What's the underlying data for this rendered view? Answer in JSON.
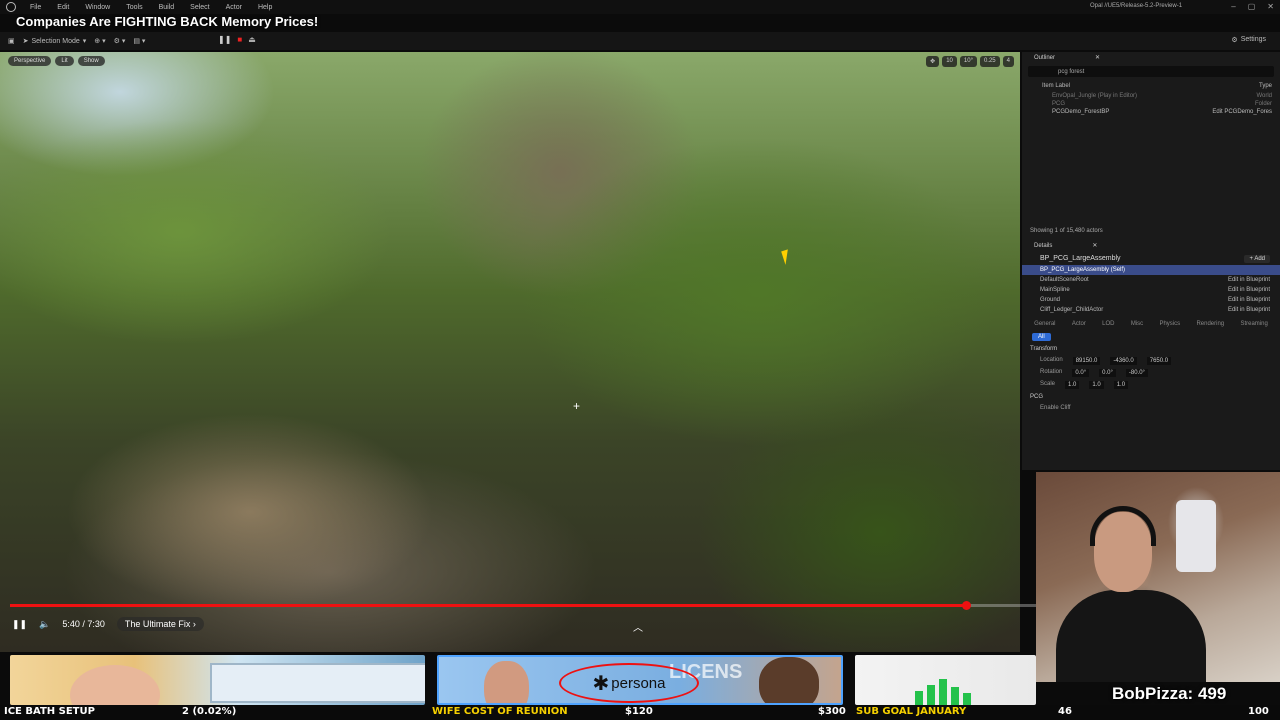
{
  "menubar": {
    "items": [
      "File",
      "Edit",
      "Window",
      "Tools",
      "Build",
      "Select",
      "Actor",
      "Help"
    ],
    "project": "Opal //UE5/Release-5.2-Preview-1"
  },
  "video": {
    "title": "Companies Are FIGHTING BACK Memory Prices!",
    "time": "5:40 / 7:30",
    "chapter": "The Ultimate Fix",
    "chapter_chevron": "›",
    "progress": 0.93
  },
  "toolbar": {
    "selection_mode": "Selection Mode",
    "settings": "Settings"
  },
  "viewport": {
    "tabs": [
      "Perspective",
      "Lit",
      "Show"
    ],
    "tools": [
      "10",
      "10°",
      "0.25",
      "4"
    ]
  },
  "outliner": {
    "tab": "Outliner",
    "search": "pcg forest",
    "col_label": "Item Label",
    "col_type": "Type",
    "rows": [
      {
        "label": "EnvOpal_Jungle (Play in Editor)",
        "type": "World"
      },
      {
        "label": "PCG",
        "type": "Folder"
      },
      {
        "label": "PCGDemo_ForestBP",
        "type": "Edit PCGDemo_Fores"
      }
    ],
    "status": "Showing 1 of 15,480 actors"
  },
  "details": {
    "tab": "Details",
    "actor": "BP_PCG_LargeAssembly",
    "add_label": "+ Add",
    "components": [
      {
        "label": "BP_PCG_LargeAssembly (Self)",
        "action": ""
      },
      {
        "label": "DefaultSceneRoot",
        "action": "Edit in Blueprint"
      },
      {
        "label": "MainSpline",
        "action": "Edit in Blueprint"
      },
      {
        "label": "Ground",
        "action": "Edit in Blueprint"
      },
      {
        "label": "Cliff_Ledger_ChildActor",
        "action": "Edit in Blueprint"
      }
    ],
    "categories": [
      "General",
      "Actor",
      "LOD",
      "Misc",
      "Physics",
      "Rendering",
      "Streaming"
    ],
    "all_label": "All",
    "transform_label": "Transform",
    "location": {
      "label": "Location",
      "x": "89150.0",
      "y": "-4360.0",
      "z": "7650.0"
    },
    "rotation": {
      "label": "Rotation",
      "x": "0.0°",
      "y": "0.0°",
      "z": "-80.0°"
    },
    "scale": {
      "label": "Scale",
      "x": "1.0",
      "y": "1.0",
      "z": "1.0"
    },
    "pcg_label": "PCG",
    "enable_cliff": "Enable Cliff"
  },
  "overlay": {
    "viewer": "BobPizza: 499"
  },
  "thumbs": {
    "persona": "persona",
    "license": "LICENS"
  },
  "ticker": {
    "item1": "ICE BATH SETUP",
    "item2": "2 (0.02%)",
    "item3": "WIFE COST OF REUNION",
    "item4": "$120",
    "item5": "$300",
    "item6": "SUB GOAL JANUARY",
    "item7": "46",
    "item8": "100"
  }
}
